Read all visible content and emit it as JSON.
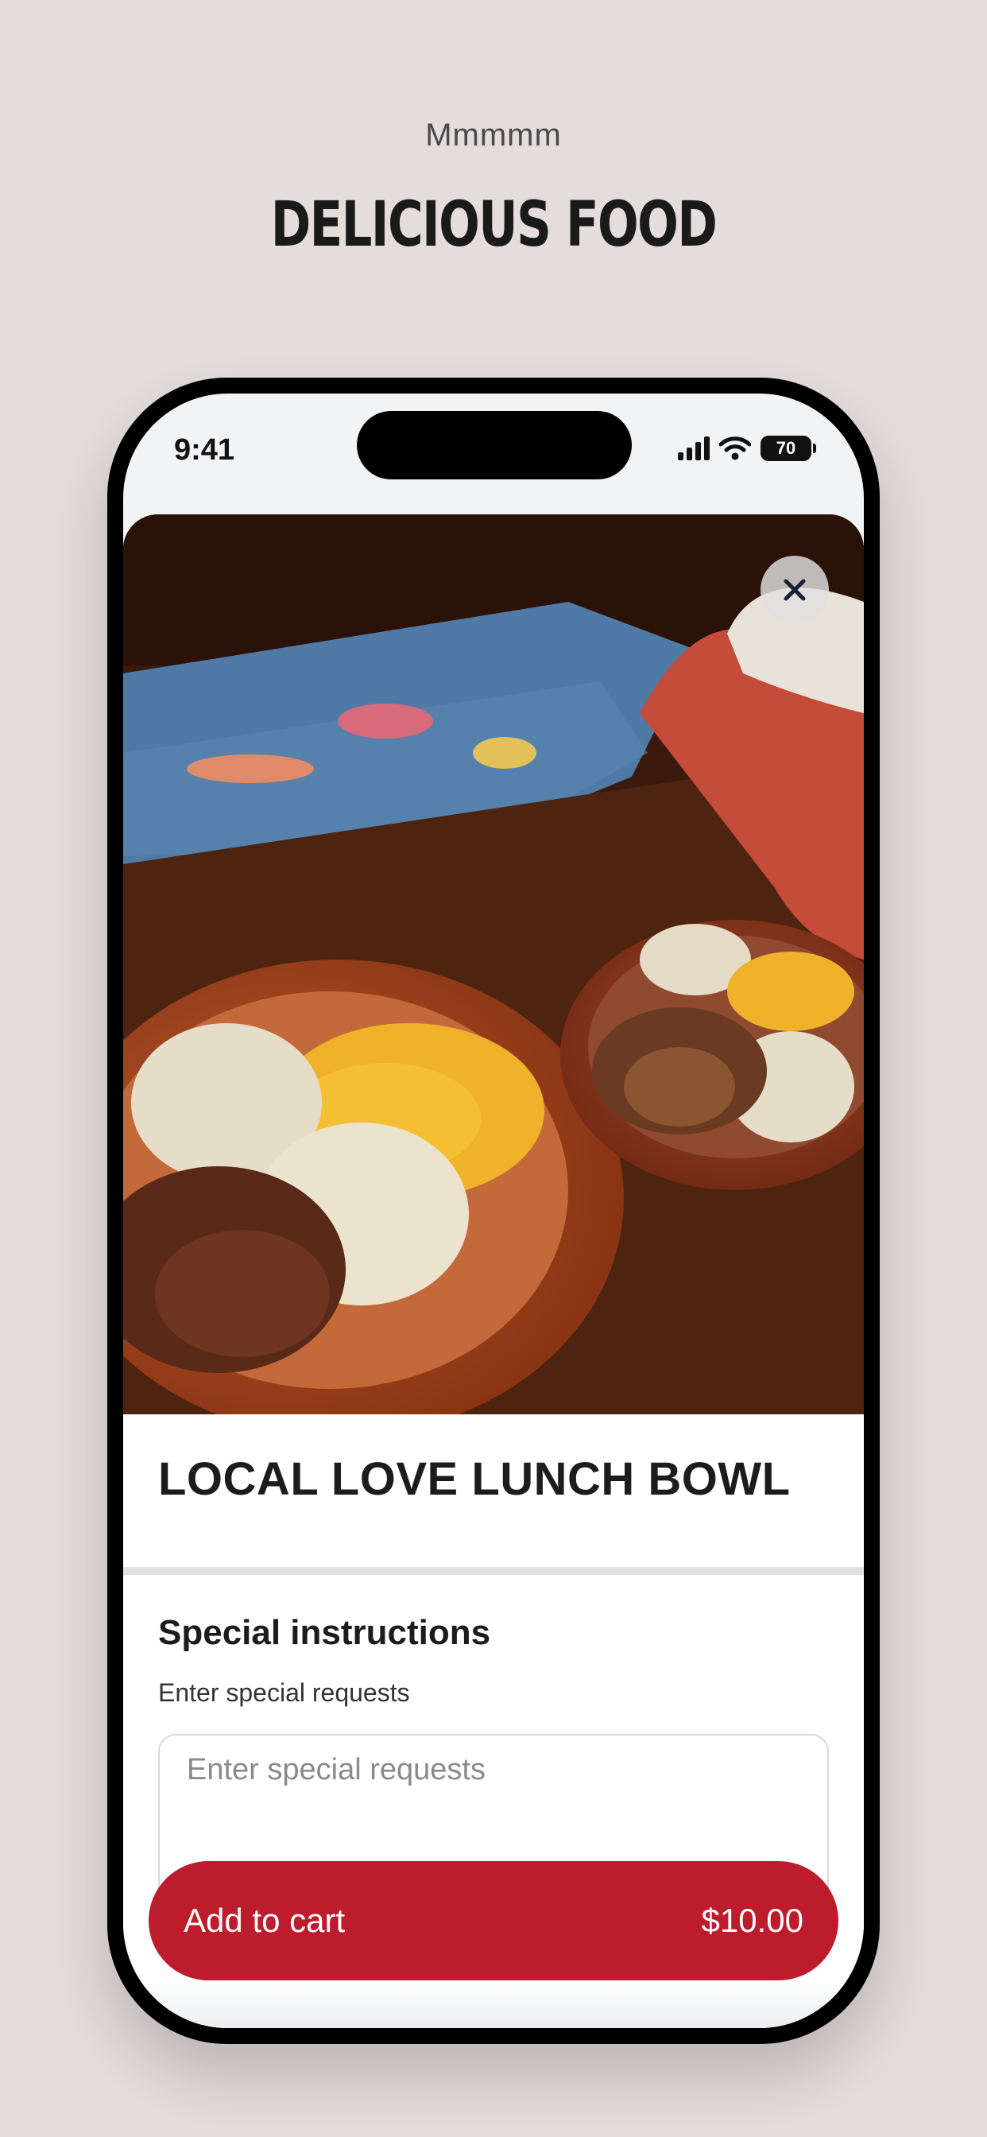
{
  "header": {
    "eyebrow": "Mmmmm",
    "headline": "DELICIOUS FOOD"
  },
  "status_bar": {
    "time": "9:41",
    "battery": "70"
  },
  "item": {
    "photo_icon": "food-photo",
    "title": "LOCAL LOVE LUNCH BOWL"
  },
  "special_instructions": {
    "title": "Special instructions",
    "label": "Enter special requests",
    "placeholder": "Enter special requests"
  },
  "cart": {
    "label": "Add to cart",
    "price": "$10.00"
  },
  "colors": {
    "background": "#e5dcdc",
    "accent": "#bd1c2d"
  }
}
